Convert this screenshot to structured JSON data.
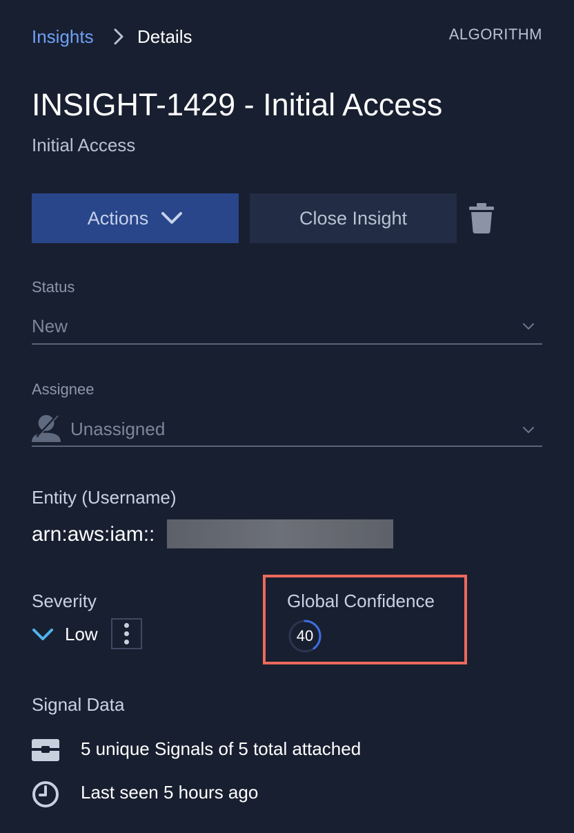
{
  "breadcrumb": {
    "parent": "Insights",
    "current": "Details"
  },
  "header": {
    "badge": "ALGORITHM"
  },
  "insight": {
    "title": "INSIGHT-1429 - Initial Access",
    "subtitle": "Initial Access"
  },
  "toolbar": {
    "actions_label": "Actions",
    "close_label": "Close Insight"
  },
  "status": {
    "label": "Status",
    "value": "New"
  },
  "assignee": {
    "label": "Assignee",
    "value": "Unassigned"
  },
  "entity": {
    "label": "Entity (Username)",
    "value": "arn:aws:iam::"
  },
  "severity": {
    "label": "Severity",
    "value": "Low"
  },
  "global_confidence": {
    "label": "Global Confidence",
    "value": "40",
    "fraction": 0.4
  },
  "signal_data": {
    "label": "Signal Data",
    "signals_text": "5 unique Signals of 5 total attached",
    "last_seen_text": "Last seen 5 hours ago"
  },
  "colors": {
    "background": "#181f30",
    "primary_button": "#29468b",
    "secondary_button": "#222c44",
    "link": "#6fa0f5",
    "highlight_border": "#ec6a5c",
    "confidence_ring": "#3d6fe0",
    "severity_low": "#4fb3ee"
  },
  "icons": {
    "breadcrumb_separator": "chevron-right-icon",
    "actions": "chevron-down-icon",
    "delete": "trash-icon",
    "assignee": "user-icon",
    "severity": "chevron-down-icon",
    "more": "kebab-icon",
    "signals": "signal-card-icon",
    "last_seen": "clock-icon"
  }
}
